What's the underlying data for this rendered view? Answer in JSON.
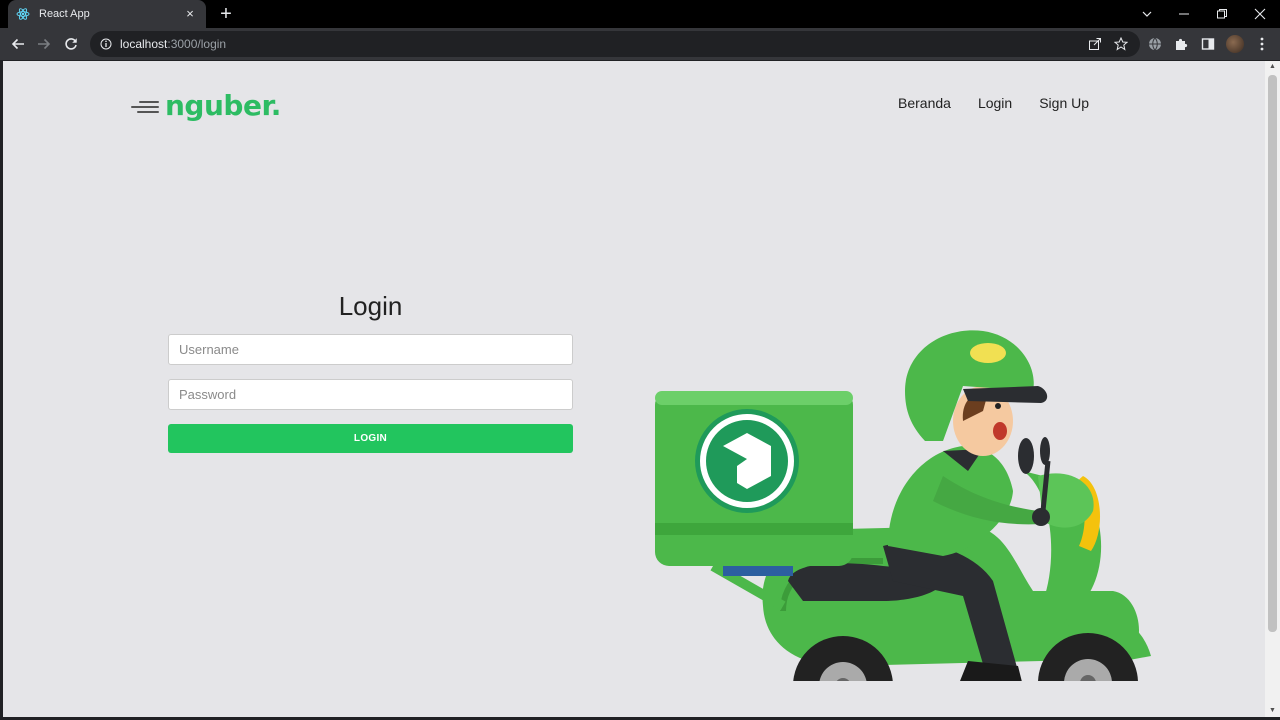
{
  "browser": {
    "tab_title": "React App",
    "tab_close": "×",
    "new_tab": "+",
    "url_host": "localhost",
    "url_rest": ":3000/login"
  },
  "site": {
    "logo_text": "nguber.",
    "brand_color": "#2dbc63",
    "nav": [
      {
        "label": "Beranda"
      },
      {
        "label": "Login"
      },
      {
        "label": "Sign Up"
      }
    ]
  },
  "form": {
    "title": "Login",
    "username_placeholder": "Username",
    "password_placeholder": "Password",
    "username_value": "",
    "password_value": "",
    "submit_label": "LOGIN",
    "button_color": "#22c55e"
  },
  "icons": {
    "back": "back-arrow-icon",
    "forward": "forward-arrow-icon",
    "reload": "reload-icon",
    "info": "info-icon",
    "share": "share-icon",
    "bookmark": "star-icon",
    "extension": "puzzle-icon"
  }
}
